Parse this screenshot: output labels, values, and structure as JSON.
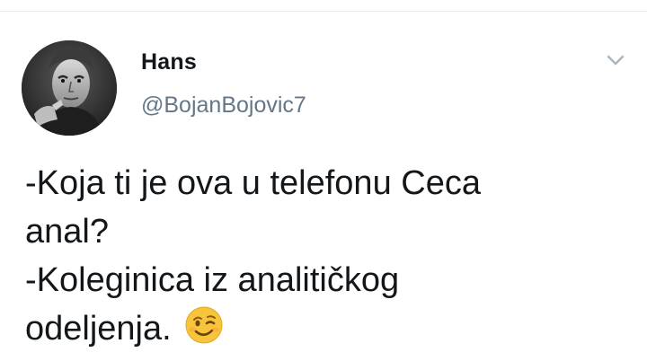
{
  "tweet": {
    "author": {
      "display_name": "Hans",
      "handle": "@BojanBojovic7",
      "avatar": "portrait-avatar"
    },
    "menu_icon": "chevron-down-icon",
    "text_lines": [
      "-Koja ti je ova u telefonu Ceca",
      "anal?",
      "-Koleginica iz analitičkog",
      "odeljenja."
    ],
    "emoji": "winking-face-emoji"
  },
  "colors": {
    "text_primary": "#14171a",
    "text_secondary": "#657786",
    "divider": "#e6ecf0",
    "chevron": "#aab8c2",
    "emoji_face": "#f7c53b"
  }
}
